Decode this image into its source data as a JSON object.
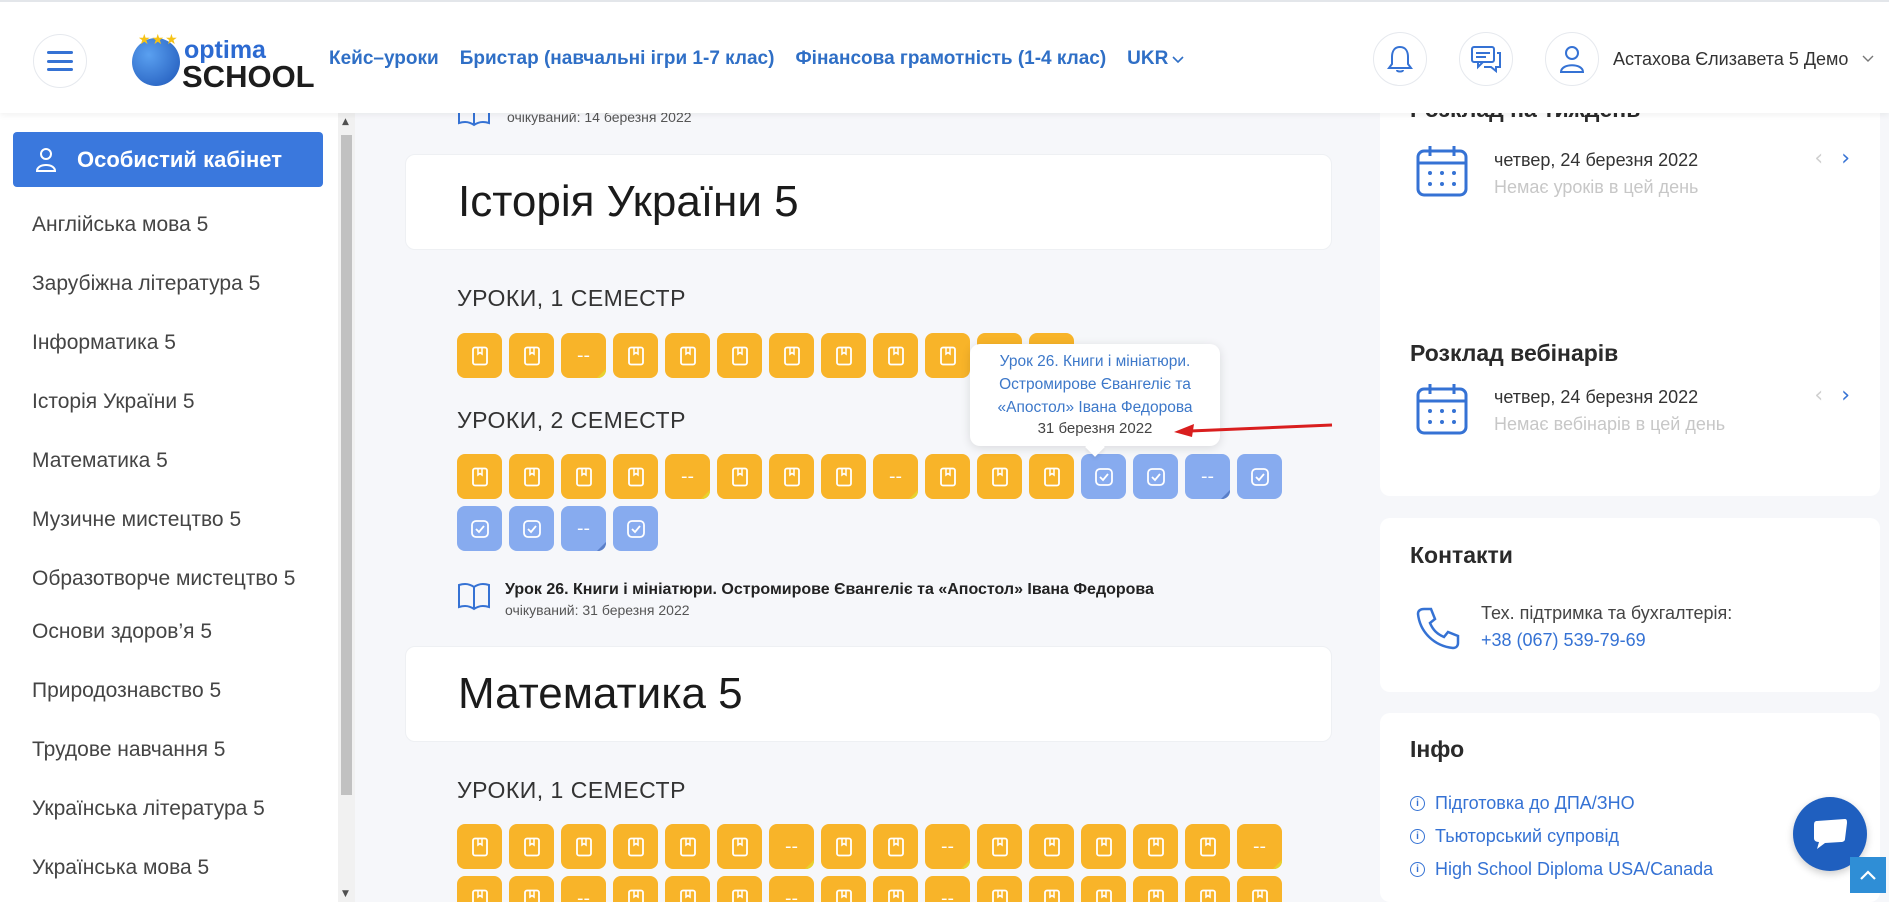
{
  "header": {
    "logo_top": "optima",
    "logo_bottom": "SCHOOL",
    "nav": [
      "Кейс–уроки",
      "Бристар (навчальні ігри 1-7 клас)",
      "Фінансова грамотність (1-4 клас)"
    ],
    "lang": "UKR",
    "user_name": "Астахова Єлизавета 5 Демо"
  },
  "sidebar": {
    "cabinet_label": "Особистий кабінет",
    "subjects": [
      "Англійська мова 5",
      "Зарубіжна література 5",
      "Інформатика 5",
      "Історія України 5",
      "Математика 5",
      "Музичне мистецтво 5",
      "Образотворче мистецтво 5",
      "Основи здоров’я 5",
      "Природознавство 5",
      "Трудове навчання 5",
      "Українська література 5",
      "Українська мова 5"
    ]
  },
  "center": {
    "prev_expected": "очікуваний: 14 березня 2022",
    "history": {
      "title": "Історія України 5",
      "sem1_label": "УРОКИ, 1 СЕМЕСТР",
      "sem2_label": "УРОКИ, 2 СЕМЕСТР",
      "sem1_squares": [
        "book",
        "book",
        "dash",
        "book",
        "book",
        "book",
        "book",
        "book",
        "book",
        "book",
        "book",
        "book"
      ],
      "sem2_squares": [
        "book",
        "book",
        "book",
        "book",
        "dash",
        "book",
        "book",
        "book",
        "dash",
        "book",
        "book",
        "book",
        "check",
        "check",
        "dash",
        "check",
        "check",
        "check",
        "dash",
        "check"
      ],
      "sem2_blue_from": 12,
      "lesson_title": "Урок 26. Книги і мініатюри. Остромирове Євангеліє та «Апостол» Івана Федорова",
      "lesson_expected": "очікуваний: 31 березня 2022"
    },
    "math": {
      "title": "Математика 5",
      "sem1_label": "УРОКИ, 1 СЕМЕСТР",
      "row1": [
        "book",
        "book",
        "book",
        "book",
        "book",
        "book",
        "dash",
        "book",
        "book",
        "dash",
        "book",
        "book",
        "book",
        "book",
        "book",
        "dash"
      ],
      "row2": [
        "book",
        "book",
        "dash",
        "book",
        "book",
        "book",
        "dash",
        "book",
        "book",
        "dash",
        "book",
        "book",
        "book",
        "book",
        "book",
        "book"
      ]
    },
    "tooltip": {
      "line1": "Урок 26. Книги і мініатюри.",
      "line2": "Остромирове Євангеліє та",
      "line3": "«Апостол» Івана Федорова",
      "date": "31 березня 2022"
    }
  },
  "right": {
    "week": {
      "title": "Розклад на тиждень",
      "date": "четвер, 24 березня 2022",
      "empty": "Немає уроків в цей день"
    },
    "webinars": {
      "title": "Розклад вебінарів",
      "date": "четвер, 24 березня 2022",
      "empty": "Немає вебінарів в цей день"
    },
    "contacts": {
      "title": "Контакти",
      "line": "Тех. підтримка та бухгалтерія:",
      "phone": "+38 (067) 539-79-69"
    },
    "info": {
      "title": "Інфо",
      "links": [
        "Підготовка до ДПА/ЗНО",
        "Тьюторський супровід",
        "High School Diploma USA/Canada"
      ]
    }
  },
  "colors": {
    "accent": "#3a78dd",
    "orange_square": "#f8b429",
    "blue_square": "#87abef",
    "arrow": "#d91e1e"
  }
}
